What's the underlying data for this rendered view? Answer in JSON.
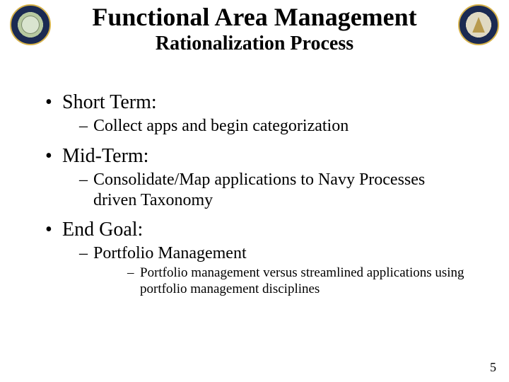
{
  "header": {
    "title": "Functional Area Management",
    "subtitle": "Rationalization Process"
  },
  "bullets": [
    {
      "label": "Short Term:",
      "sub": [
        {
          "text": "Collect apps and begin categorization"
        }
      ]
    },
    {
      "label": "Mid-Term:",
      "sub": [
        {
          "text": "Consolidate/Map applications to Navy Processes driven Taxonomy"
        }
      ]
    },
    {
      "label": "End Goal:",
      "sub": [
        {
          "text": "Portfolio Management",
          "sub": [
            {
              "text": "Portfolio management versus streamlined applications using portfolio management disciplines"
            }
          ]
        }
      ]
    }
  ],
  "page_number": "5"
}
